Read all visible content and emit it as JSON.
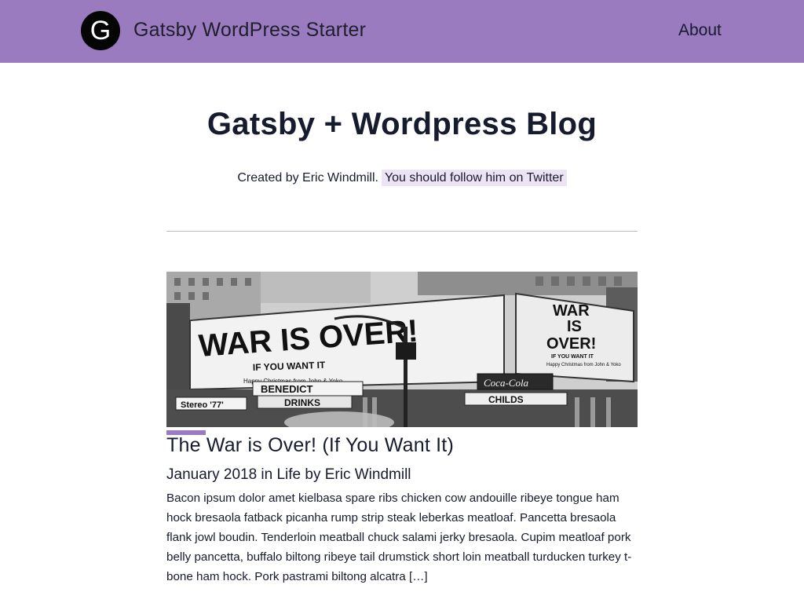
{
  "header": {
    "logo_letter": "G",
    "site_title": "Gatsby WordPress Starter",
    "nav": [
      {
        "label": "About"
      }
    ]
  },
  "page": {
    "title": "Gatsby + Wordpress Blog",
    "byline_text": "Created by Eric Windmill.",
    "twitter_link": "You should follow him on Twitter"
  },
  "posts": [
    {
      "image": {
        "billboard_left_headline": "WAR IS OVER!",
        "billboard_left_sub": "IF YOU WANT IT",
        "billboard_left_small": "Happy Christmas from John & Yoko",
        "billboard_right_line1": "WAR",
        "billboard_right_line2": "IS",
        "billboard_right_line3": "OVER!",
        "billboard_right_sub": "IF YOU WANT IT",
        "billboard_right_small": "Happy Christmas from John & Yoko",
        "sign_benedict": "BENEDICT",
        "sign_stereo": "Stereo '77'",
        "sign_drinks": "DRINKS",
        "sign_cocacola": "Coca-Cola",
        "sign_childs": "CHILDS"
      },
      "title": "The War is Over! (If You Want It)",
      "meta": "January 2018 in Life by Eric Windmill",
      "excerpt": "Bacon ipsum dolor amet kielbasa spare ribs chicken cow andouille ribeye tongue ham hock bresaola fatback picanha rump strip steak leberkas meatloaf. Pancetta bresaola flank jowl boudin. Tenderloin meatball chuck salami jerky bresaola. Cupim meatloaf pork belly pancetta, buffalo biltong ribeye tail drumstick short loin meatball turducken turkey t-bone ham hock. Pork pastrami biltong alcatra […]"
    }
  ],
  "colors": {
    "header_bg": "#9b7bc0",
    "accent": "#9b7bc0",
    "link_highlight": "#ece3f4",
    "text": "#161b2e"
  }
}
